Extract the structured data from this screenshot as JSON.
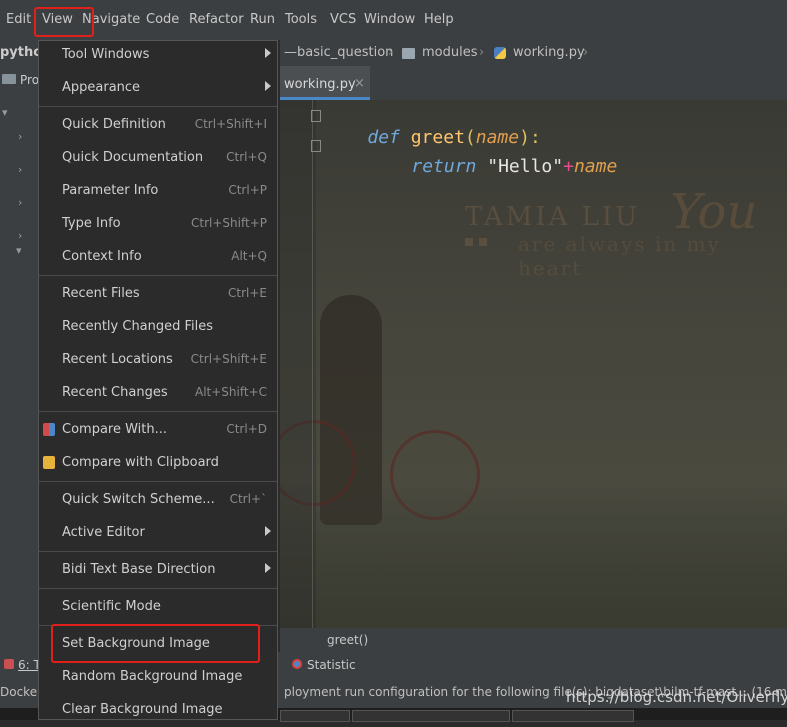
{
  "menubar": {
    "items": [
      "Edit",
      "View",
      "Navigate",
      "Code",
      "Refactor",
      "Run",
      "Tools",
      "VCS",
      "Window",
      "Help"
    ]
  },
  "left_panel": {
    "title": "pytho",
    "project_label": "Pro"
  },
  "navbar": {
    "crumbs": [
      "—basic_question",
      "modules",
      "working.py"
    ]
  },
  "tabs": [
    {
      "label": "working.py",
      "close": "×"
    }
  ],
  "code": {
    "line1": {
      "kw": "def",
      "fn": "greet",
      "paren_open": "(",
      "param": "name",
      "paren_close": "):"
    },
    "line2": {
      "kw": "return",
      "str": "\"Hello\"",
      "op": "+",
      "var": "name"
    }
  },
  "watermark": {
    "name": "TAMIA LIU",
    "script": "You",
    "tagline": "are always in my heart"
  },
  "structure_crumb": "greet()",
  "toolwin": {
    "left_label": "6: T",
    "statistic": "Statistic"
  },
  "statusbar": {
    "left": "Docker",
    "message": "ployment run configuration for the following file(s): bigdataset\\bilm-tf-mast... (16 minutes"
  },
  "url_watermark": "https://blog.csdn.net/Oliverfly1",
  "view_menu": [
    {
      "label": "Tool Windows",
      "submenu": true
    },
    {
      "label": "Appearance",
      "submenu": true
    },
    {
      "sep": true
    },
    {
      "label": "Quick Definition",
      "shortcut": "Ctrl+Shift+I"
    },
    {
      "label": "Quick Documentation",
      "shortcut": "Ctrl+Q"
    },
    {
      "label": "Parameter Info",
      "shortcut": "Ctrl+P"
    },
    {
      "label": "Type Info",
      "shortcut": "Ctrl+Shift+P"
    },
    {
      "label": "Context Info",
      "shortcut": "Alt+Q"
    },
    {
      "sep": true
    },
    {
      "label": "Recent Files",
      "shortcut": "Ctrl+E"
    },
    {
      "label": "Recently Changed Files"
    },
    {
      "label": "Recent Locations",
      "shortcut": "Ctrl+Shift+E"
    },
    {
      "label": "Recent Changes",
      "shortcut": "Alt+Shift+C"
    },
    {
      "sep": true
    },
    {
      "label": "Compare With...",
      "shortcut": "Ctrl+D",
      "icon": "compare"
    },
    {
      "label": "Compare with Clipboard",
      "icon": "clipboard"
    },
    {
      "sep": true
    },
    {
      "label": "Quick Switch Scheme...",
      "shortcut": "Ctrl+`"
    },
    {
      "label": "Active Editor",
      "submenu": true
    },
    {
      "sep": true
    },
    {
      "label": "Bidi Text Base Direction",
      "submenu": true
    },
    {
      "sep": true
    },
    {
      "label": "Scientific Mode"
    },
    {
      "sep": true
    },
    {
      "label": "Set Background Image",
      "highlight": true
    },
    {
      "label": "Random Background Image"
    },
    {
      "label": "Clear Background Image"
    }
  ],
  "colors": {
    "menubar_bg": "#3c3f41",
    "menu_bg": "#2b2b2b",
    "highlight_border": "#e0201a",
    "keyword": "#6fa8dc",
    "function": "#ffc66d",
    "param": "#e0a050",
    "string": "#e6e6e6",
    "operator": "#e05090"
  }
}
